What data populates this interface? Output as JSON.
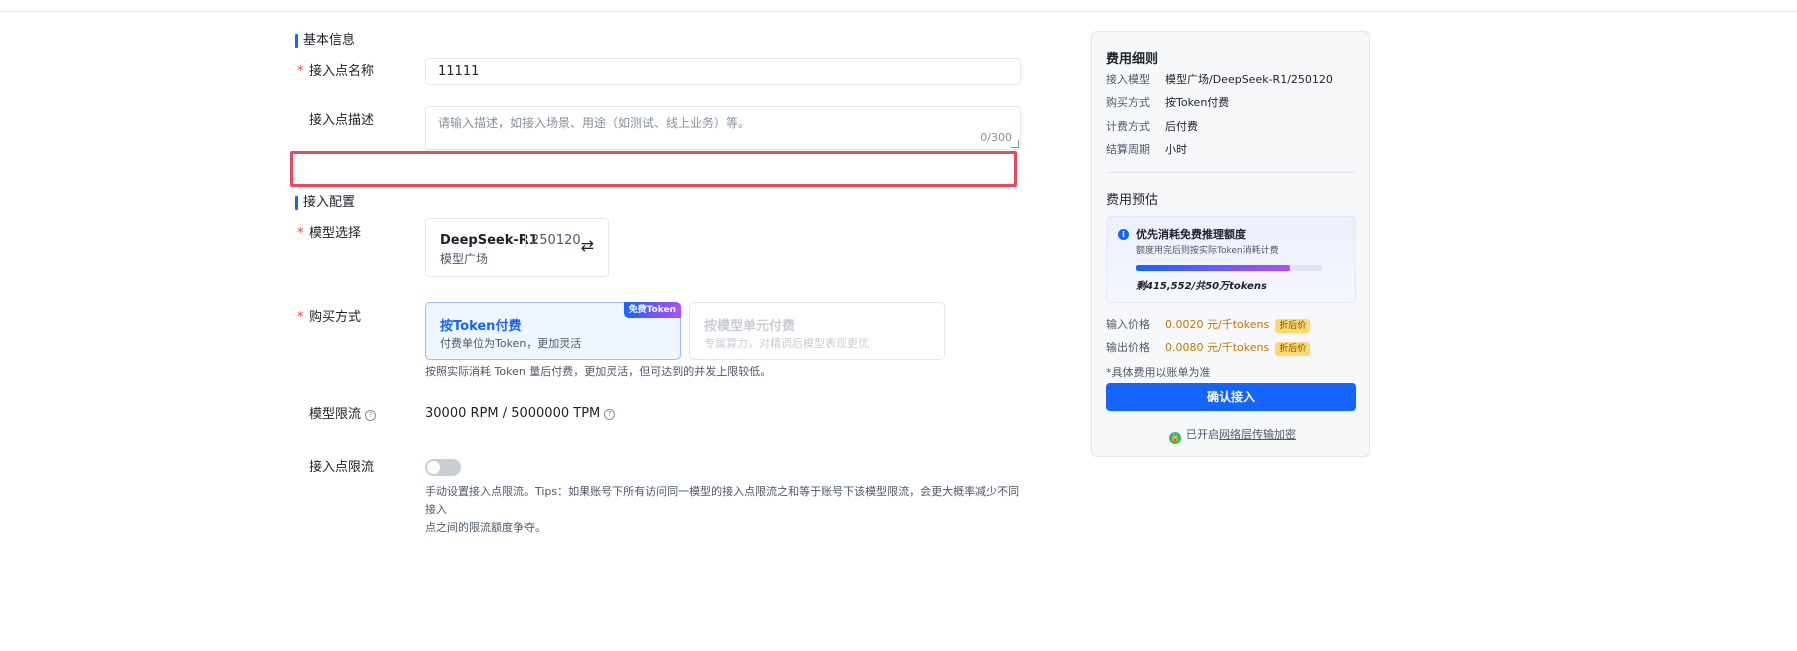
{
  "basic": {
    "section_title": "基本信息",
    "name_label": "接入点名称",
    "name_value": "11111",
    "desc_label": "接入点描述",
    "desc_placeholder": "请输入描述，如接入场景、用途（如测试、线上业务）等。",
    "desc_counter": "0/300"
  },
  "config": {
    "section_title": "接入配置",
    "model_label": "模型选择",
    "model_name": "DeepSeek-R1",
    "model_version": "250120",
    "model_source": "模型广场",
    "purchase_label": "购买方式",
    "purchase_options": [
      {
        "title": "按Token付费",
        "desc": "付费单位为Token，更加灵活",
        "badge": "免费Token"
      },
      {
        "title": "按模型单元付费",
        "desc": "专属算力，对精调后模型表现更优"
      }
    ],
    "purchase_hint": "按照实际消耗 Token 量后付费，更加灵活，但可达到的并发上限较低。",
    "rate_label": "模型限流",
    "rate_value": "30000 RPM / 5000000 TPM",
    "endpoint_rate_label": "接入点限流",
    "endpoint_rate_enabled": false,
    "endpoint_rate_hint_1": "手动设置接入点限流。Tips：如果账号下所有访问同一模型的接入点限流之和等于账号下该模型限流，会更大概率减少不同接入",
    "endpoint_rate_hint_2": "点之间的限流额度争夺。"
  },
  "fee": {
    "title": "费用细则",
    "rows": [
      {
        "k": "接入模型",
        "v": "模型广场/DeepSeek-R1/250120"
      },
      {
        "k": "购买方式",
        "v": "按Token付费"
      },
      {
        "k": "计费方式",
        "v": "后付费"
      },
      {
        "k": "结算周期",
        "v": "小时"
      }
    ],
    "estimate_title": "费用预估",
    "notice_title": "优先消耗免费推理额度",
    "notice_desc": "额度用完后则按实际Token消耗计费",
    "remaining_fraction": 0.83,
    "remaining_text": "剩415,552/共50万tokens",
    "input_price_label": "输入价格",
    "input_price": "0.0020 元/千tokens",
    "output_price_label": "输出价格",
    "output_price": "0.0080 元/千tokens",
    "discount_tag": "折后价",
    "note": "*具体费用以账单为准",
    "confirm_label": "确认接入",
    "secure_prefix": "已开启",
    "secure_link": "网络层传输加密"
  }
}
